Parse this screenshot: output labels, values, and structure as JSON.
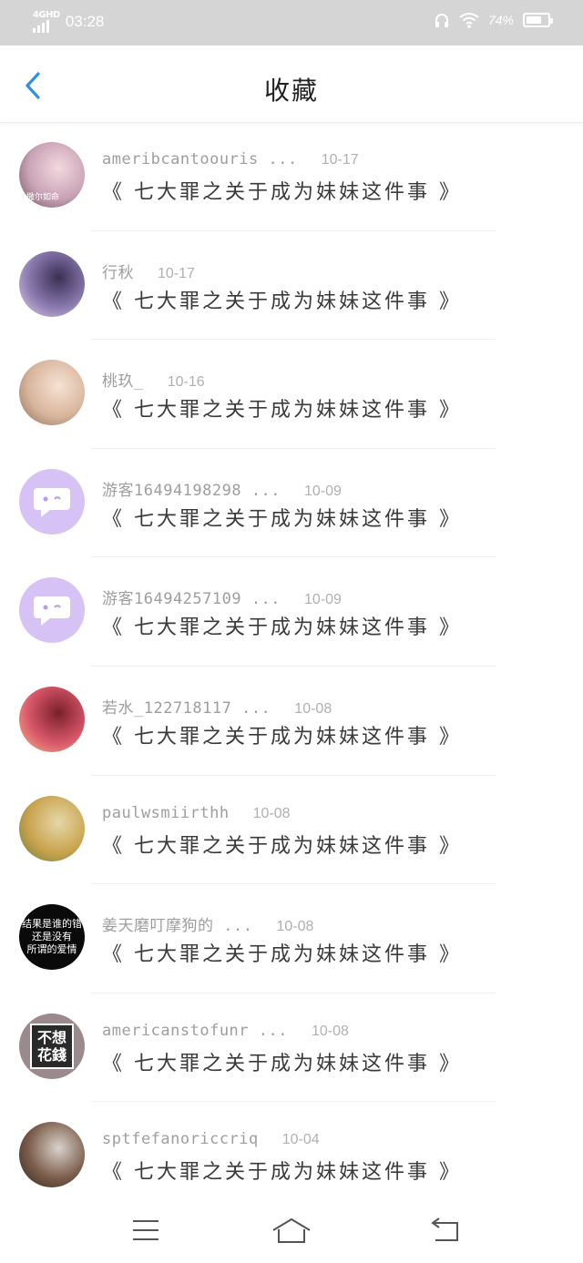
{
  "status_bar": {
    "network": "4GHD",
    "time": "03:28",
    "battery_percent": "74%",
    "battery_level": 0.74,
    "icons": [
      "headphones-icon",
      "wifi-icon",
      "battery-icon"
    ]
  },
  "header": {
    "title": "收藏",
    "back_icon": "chevron-left-icon",
    "accent_color": "#2d8fe8"
  },
  "favorites": [
    {
      "username": "ameribcantoouris ...",
      "date": "10-17",
      "title": "《 七大罪之关于成为妹妹这件事 》",
      "avatar": "photo",
      "avatar_text": "撒尔如命"
    },
    {
      "username": "行秋",
      "date": "10-17",
      "title": "《 七大罪之关于成为妹妹这件事 》",
      "avatar": "photo",
      "avatar_text": ""
    },
    {
      "username": "桃玖_",
      "date": "10-16",
      "title": "《 七大罪之关于成为妹妹这件事 》",
      "avatar": "photo",
      "avatar_text": ""
    },
    {
      "username": "游客16494198298 ...",
      "date": "10-09",
      "title": "《 七大罪之关于成为妹妹这件事 》",
      "avatar": "guest",
      "avatar_text": ""
    },
    {
      "username": "游客16494257109 ...",
      "date": "10-09",
      "title": "《 七大罪之关于成为妹妹这件事 》",
      "avatar": "guest",
      "avatar_text": ""
    },
    {
      "username": "若水_122718117 ...",
      "date": "10-08",
      "title": "《 七大罪之关于成为妹妹这件事 》",
      "avatar": "photo",
      "avatar_text": ""
    },
    {
      "username": "paulwsmiirthh",
      "date": "10-08",
      "title": "《 七大罪之关于成为妹妹这件事 》",
      "avatar": "photo",
      "avatar_text": ""
    },
    {
      "username": "姜天磨叮摩狗的 ...",
      "date": "10-08",
      "title": "《 七大罪之关于成为妹妹这件事 》",
      "avatar": "black",
      "avatar_text": "结果是谁的错\n还是没有\n所谓的爱情"
    },
    {
      "username": "americanstofunr ...",
      "date": "10-08",
      "title": "《 七大罪之关于成为妹妹这件事 》",
      "avatar": "tile",
      "avatar_text": "不想\n花錢"
    },
    {
      "username": "sptfefanoriccriq",
      "date": "10-04",
      "title": "《 七大罪之关于成为妹妹这件事 》",
      "avatar": "photo",
      "avatar_text": ""
    }
  ],
  "nav": {
    "menu_icon": "menu-icon",
    "home_icon": "home-icon",
    "back_icon": "back-arrow-icon"
  }
}
